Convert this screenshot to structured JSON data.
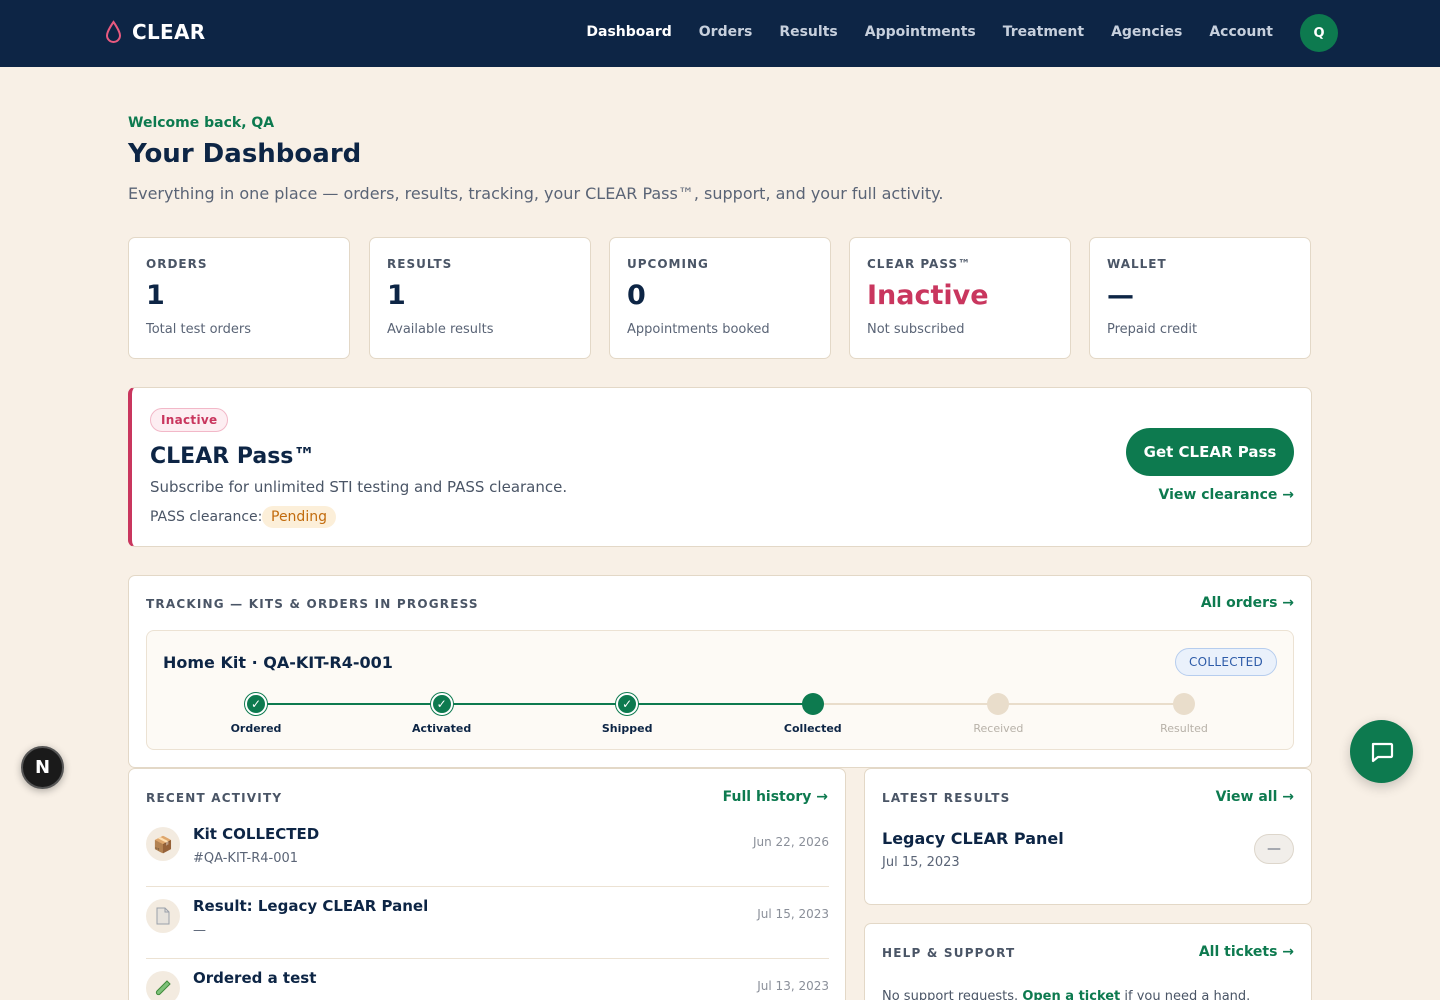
{
  "nav": {
    "brand": "CLEAR",
    "links": [
      "Dashboard",
      "Orders",
      "Results",
      "Appointments",
      "Treatment",
      "Agencies",
      "Account"
    ],
    "active": "Dashboard",
    "avatar_initial": "Q"
  },
  "header": {
    "welcome": "Welcome back, QA",
    "title": "Your Dashboard",
    "subtitle": "Everything in one place — orders, results, tracking, your CLEAR Pass™, support, and your full activity."
  },
  "stats": [
    {
      "label": "ORDERS",
      "value": "1",
      "sub": "Total test orders"
    },
    {
      "label": "RESULTS",
      "value": "1",
      "sub": "Available results"
    },
    {
      "label": "UPCOMING",
      "value": "0",
      "sub": "Appointments booked"
    },
    {
      "label": "CLEAR PASS™",
      "value": "Inactive",
      "sub": "Not subscribed"
    },
    {
      "label": "WALLET",
      "value": "—",
      "sub": "Prepaid credit"
    }
  ],
  "pass": {
    "badge": "Inactive",
    "title": "CLEAR Pass™",
    "description": "Subscribe for unlimited STI testing and PASS clearance.",
    "clearance_label": "PASS clearance:",
    "clearance_status": "Pending",
    "cta": "Get CLEAR Pass",
    "link": "View clearance →"
  },
  "tracking": {
    "label": "TRACKING — KITS & ORDERS IN PROGRESS",
    "link": "All orders →",
    "kit_title": "Home Kit · QA-KIT-R4-001",
    "kit_status": "COLLECTED",
    "steps": [
      "Ordered",
      "Activated",
      "Shipped",
      "Collected",
      "Received",
      "Resulted"
    ],
    "current_step": 4
  },
  "activity": {
    "label": "RECENT ACTIVITY",
    "link": "Full history →",
    "items": [
      {
        "icon": "package-icon",
        "title": "Kit COLLECTED",
        "sub": "#QA-KIT-R4-001",
        "date": "Jun 22, 2026"
      },
      {
        "icon": "document-icon",
        "title": "Result: Legacy CLEAR Panel",
        "sub": "—",
        "date": "Jul 15, 2023"
      },
      {
        "icon": "test-tube-icon",
        "title": "Ordered a test",
        "sub": "",
        "date": "Jul 13, 2023"
      }
    ]
  },
  "results": {
    "label": "LATEST RESULTS",
    "link": "View all →",
    "name": "Legacy CLEAR Panel",
    "date": "Jul 15, 2023",
    "badge": "—"
  },
  "help": {
    "label": "HELP & SUPPORT",
    "link": "All tickets →",
    "text_before": "No support requests. ",
    "text_link": "Open a ticket",
    "text_after": " if you need a hand."
  },
  "floating": {
    "n_badge": "N"
  },
  "colors": {
    "navy": "#0d2545",
    "green": "#0d7a4f",
    "rose": "#c9365e",
    "cream": "#f8f0e6"
  }
}
